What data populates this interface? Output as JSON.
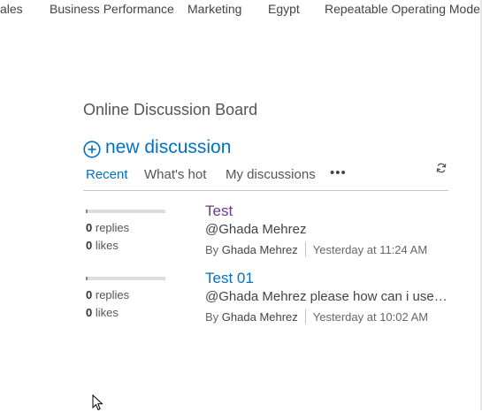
{
  "topnav": {
    "tabs": [
      "ales",
      "Business Performance",
      "Marketing",
      "Egypt",
      "Repeatable Operating Model ("
    ]
  },
  "board": {
    "title": "Online Discussion Board",
    "new_discussion": "new discussion",
    "views": [
      "Recent",
      "What's hot",
      "My discussions"
    ],
    "active_view": "Recent",
    "more": "•••"
  },
  "posts": [
    {
      "replies_count": "0",
      "replies_label": "replies",
      "likes_count": "0",
      "likes_label": "likes",
      "activity_fraction": 0.0,
      "title": "Test",
      "title_color": "#6b3a8c",
      "preview": "@Ghada Mehrez",
      "by": "By",
      "author": "Ghada Mehrez",
      "time": "Yesterday at 11:24 AM"
    },
    {
      "replies_count": "0",
      "replies_label": "replies",
      "likes_count": "0",
      "likes_label": "likes",
      "activity_fraction": 0.0,
      "title": "Test 01",
      "title_color": "#0072c6",
      "preview": "@Ghada Mehrez please how can i use t...",
      "by": "By",
      "author": "Ghada Mehrez",
      "time": "Yesterday at 10:02 AM"
    }
  ],
  "colors": {
    "accent": "#0072c6",
    "visited_link": "#6b3a8c",
    "text": "#444444",
    "divider": "#c8c8c8"
  }
}
